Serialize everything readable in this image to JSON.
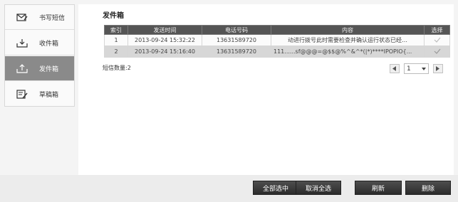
{
  "sidebar": {
    "items": [
      {
        "label": "书写短信",
        "icon": "compose-icon",
        "active": false
      },
      {
        "label": "收件箱",
        "icon": "inbox-icon",
        "active": false
      },
      {
        "label": "发件箱",
        "icon": "outbox-icon",
        "active": true
      },
      {
        "label": "草稿箱",
        "icon": "drafts-icon",
        "active": false
      }
    ]
  },
  "main": {
    "title": "发件箱",
    "table": {
      "headers": [
        "索引",
        "发送时间",
        "电话号码",
        "内容",
        "选择"
      ],
      "rows": [
        {
          "index": "1",
          "time": "2013-09-24 15:32:22",
          "phone": "13631589720",
          "content": "动进行拨号此时需要检查并确认运行状态已经…"
        },
        {
          "index": "2",
          "time": "2013-09-24 15:16:40",
          "phone": "13631589720",
          "content": "111......sf@@@=@$$@%^&^*(|*)****IPOPIO{..."
        }
      ]
    },
    "count_label": "短信数量:2",
    "pager": {
      "page": "1"
    }
  },
  "actions": {
    "select_all": "全部选中",
    "cancel_all": "取消全选",
    "refresh": "刷新",
    "delete": "删除"
  },
  "colors": {
    "header_bg": "#555555",
    "active_item": "#8a8a8a",
    "button_bg": "#333333"
  }
}
